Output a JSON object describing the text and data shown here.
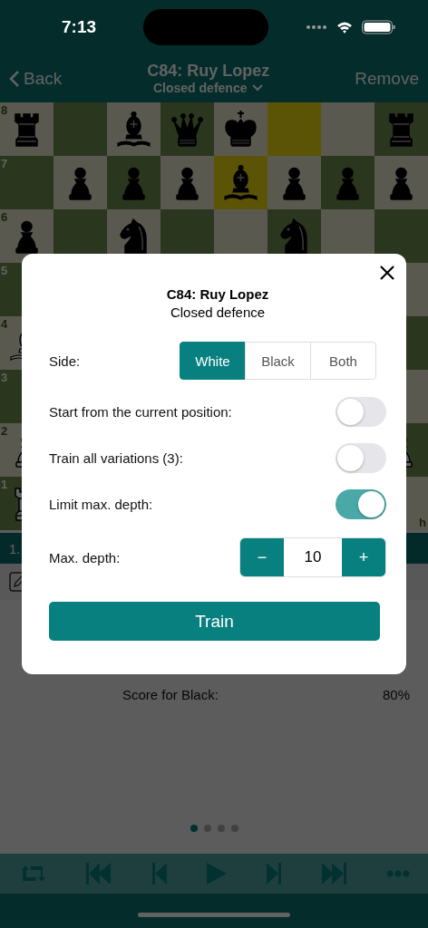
{
  "status_bar": {
    "time": "7:13"
  },
  "nav": {
    "back": "Back",
    "title": "C84: Ruy Lopez",
    "subtitle": "Closed defence",
    "action": "Remove"
  },
  "board": {
    "file_label": "h",
    "ranks": [
      {
        "label": "8",
        "squares": [
          {
            "kind": "rook",
            "white": false,
            "highlighted": false
          },
          {
            "highlighted": false
          },
          {
            "kind": "bishop",
            "white": false,
            "highlighted": false
          },
          {
            "kind": "queen",
            "white": false,
            "highlighted": false
          },
          {
            "kind": "king",
            "white": false,
            "highlighted": false
          },
          {
            "highlighted": true
          },
          {
            "highlighted": false
          },
          {
            "kind": "rook",
            "white": false,
            "highlighted": false
          }
        ]
      },
      {
        "label": "7",
        "squares": [
          {
            "highlighted": false
          },
          {
            "kind": "pawn",
            "white": false,
            "highlighted": false
          },
          {
            "kind": "pawn",
            "white": false,
            "highlighted": false
          },
          {
            "kind": "pawn",
            "white": false,
            "highlighted": false
          },
          {
            "kind": "bishop",
            "white": false,
            "highlighted": true
          },
          {
            "kind": "pawn",
            "white": false,
            "highlighted": false
          },
          {
            "kind": "pawn",
            "white": false,
            "highlighted": false
          },
          {
            "kind": "pawn",
            "white": false,
            "highlighted": false
          }
        ]
      },
      {
        "label": "6",
        "squares": [
          {
            "kind": "pawn",
            "white": false,
            "highlighted": false
          },
          {
            "highlighted": false
          },
          {
            "kind": "knight",
            "white": false,
            "highlighted": false
          },
          {
            "highlighted": false
          },
          {
            "highlighted": false
          },
          {
            "kind": "knight",
            "white": false,
            "highlighted": false
          },
          {
            "highlighted": false
          },
          {
            "highlighted": false
          }
        ]
      },
      {
        "label": "5",
        "squares": [
          {
            "highlighted": false
          },
          {
            "highlighted": false
          }
        ]
      },
      {
        "label": "4",
        "squares": [
          {
            "kind": "bishop",
            "white": true,
            "highlighted": false
          },
          {
            "highlighted": false
          }
        ]
      },
      {
        "label": "3",
        "squares": [
          {
            "highlighted": false
          },
          {
            "highlighted": false
          }
        ]
      },
      {
        "label": "2",
        "squares": [
          {
            "kind": "pawn",
            "white": true,
            "highlighted": false
          },
          {
            "kind": "pawn",
            "white": true,
            "highlighted": false
          }
        ]
      },
      {
        "label": "1",
        "squares": [
          {
            "kind": "rook",
            "white": true,
            "highlighted": false
          },
          {
            "highlighted": false
          }
        ]
      }
    ]
  },
  "move_bar": {
    "text": "1."
  },
  "stats": {
    "label": "Score for Black:",
    "value": "80%"
  },
  "page_dots": [
    {
      "selected": true
    },
    {
      "selected": false
    },
    {
      "selected": false
    },
    {
      "selected": false
    }
  ],
  "toolbar": [
    {
      "kind": "flip"
    },
    {
      "kind": "first"
    },
    {
      "kind": "prev"
    },
    {
      "kind": "play"
    },
    {
      "kind": "next"
    },
    {
      "kind": "last"
    },
    {
      "kind": "more"
    }
  ],
  "dialog": {
    "title": "C84: Ruy Lopez",
    "subtitle": "Closed defence",
    "side": {
      "label": "Side:",
      "options": [
        {
          "label": "White",
          "selected": true
        },
        {
          "label": "Black",
          "selected": false
        },
        {
          "label": "Both",
          "selected": false
        }
      ]
    },
    "toggles": [
      {
        "label": "Start from the current position:",
        "on": false
      },
      {
        "label": "Train all variations (3):",
        "on": false
      },
      {
        "label": "Limit max. depth:",
        "on": true
      }
    ],
    "depth": {
      "label": "Max. depth:",
      "decrement": "−",
      "value": "10",
      "increment": "+"
    },
    "train_button": "Train"
  }
}
